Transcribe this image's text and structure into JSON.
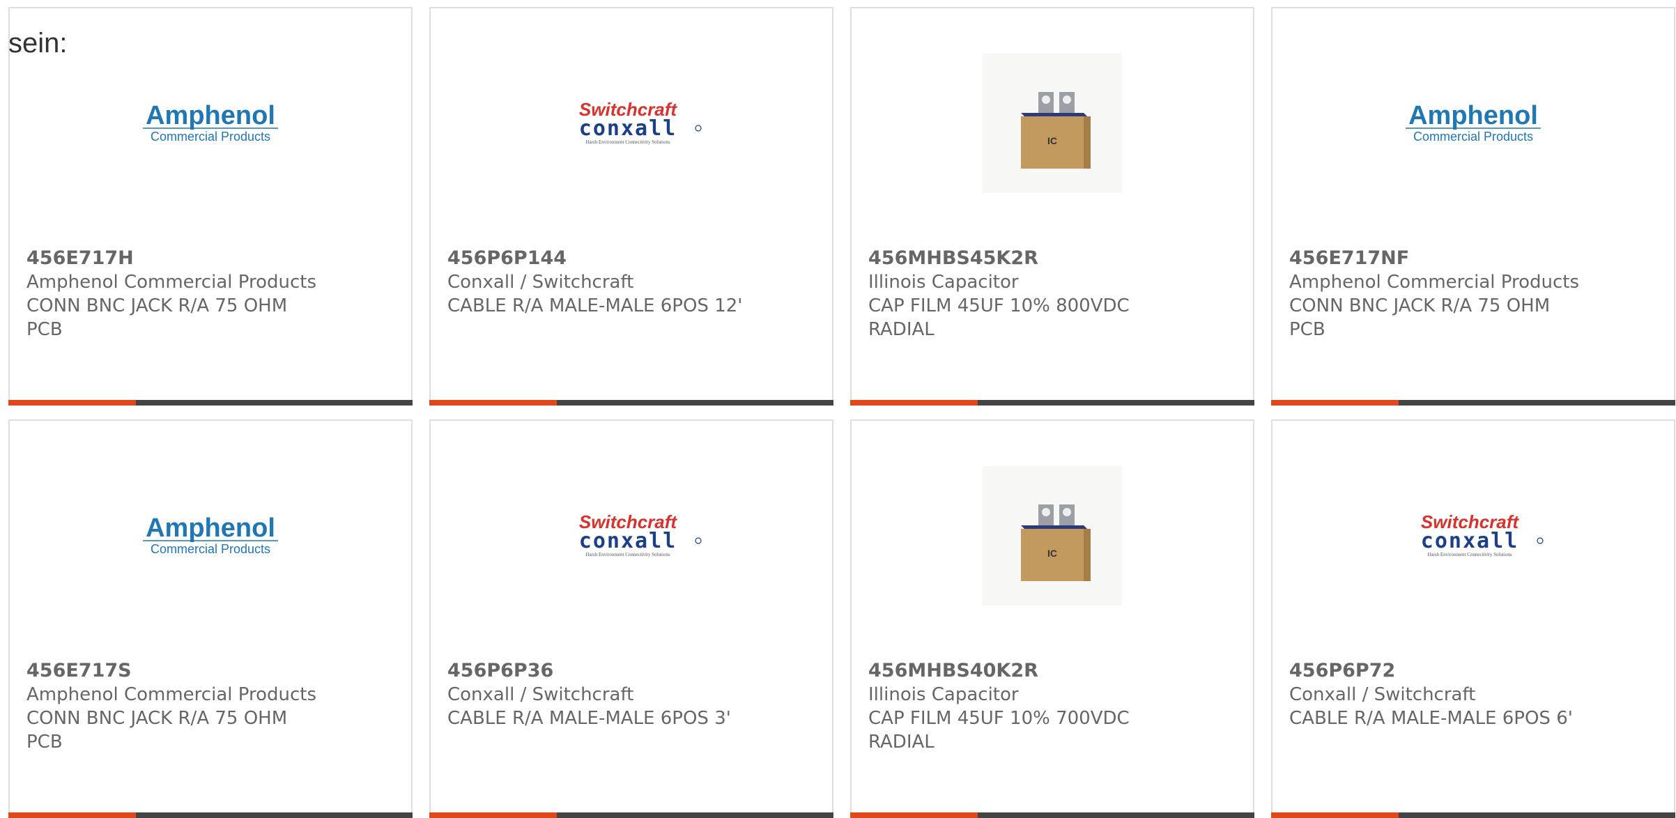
{
  "intro_text": "sein:",
  "colors": {
    "accent": "#e2471a",
    "bar": "#444444",
    "amphenol_blue": "#1f77b4",
    "switchcraft_red": "#d8322c",
    "conxall_blue": "#1c3f8a"
  },
  "logos": {
    "amphenol_title": "Amphenol",
    "amphenol_sub": "Commercial Products",
    "switchcraft_title": "Switchcraft",
    "conxall_title": "conxall",
    "conxall_tagline": "Harsh Environment Connectivity Solutions",
    "capacitor_mark": "IC"
  },
  "products": [
    {
      "part": "456E717H",
      "maker": "Amphenol Commercial Products",
      "desc1": "CONN BNC JACK R/A 75 OHM",
      "desc2": "PCB",
      "logo": "amphenol-logo"
    },
    {
      "part": "456P6P144",
      "maker": "Conxall / Switchcraft",
      "desc1": "CABLE R/A MALE-MALE 6POS 12'",
      "desc2": "",
      "logo": "switchcraft-conxall-logo"
    },
    {
      "part": "456MHBS45K2R",
      "maker": "Illinois Capacitor",
      "desc1": "CAP FILM 45UF 10% 800VDC",
      "desc2": "RADIAL",
      "logo": "capacitor-image"
    },
    {
      "part": "456E717NF",
      "maker": "Amphenol Commercial Products",
      "desc1": "CONN BNC JACK R/A 75 OHM",
      "desc2": "PCB",
      "logo": "amphenol-logo"
    },
    {
      "part": "456E717S",
      "maker": "Amphenol Commercial Products",
      "desc1": "CONN BNC JACK R/A 75 OHM",
      "desc2": "PCB",
      "logo": "amphenol-logo"
    },
    {
      "part": "456P6P36",
      "maker": "Conxall / Switchcraft",
      "desc1": "CABLE R/A MALE-MALE 6POS 3'",
      "desc2": "",
      "logo": "switchcraft-conxall-logo"
    },
    {
      "part": "456MHBS40K2R",
      "maker": "Illinois Capacitor",
      "desc1": "CAP FILM 45UF 10% 700VDC",
      "desc2": "RADIAL",
      "logo": "capacitor-image"
    },
    {
      "part": "456P6P72",
      "maker": "Conxall / Switchcraft",
      "desc1": "CABLE R/A MALE-MALE 6POS 6'",
      "desc2": "",
      "logo": "switchcraft-conxall-logo"
    }
  ]
}
